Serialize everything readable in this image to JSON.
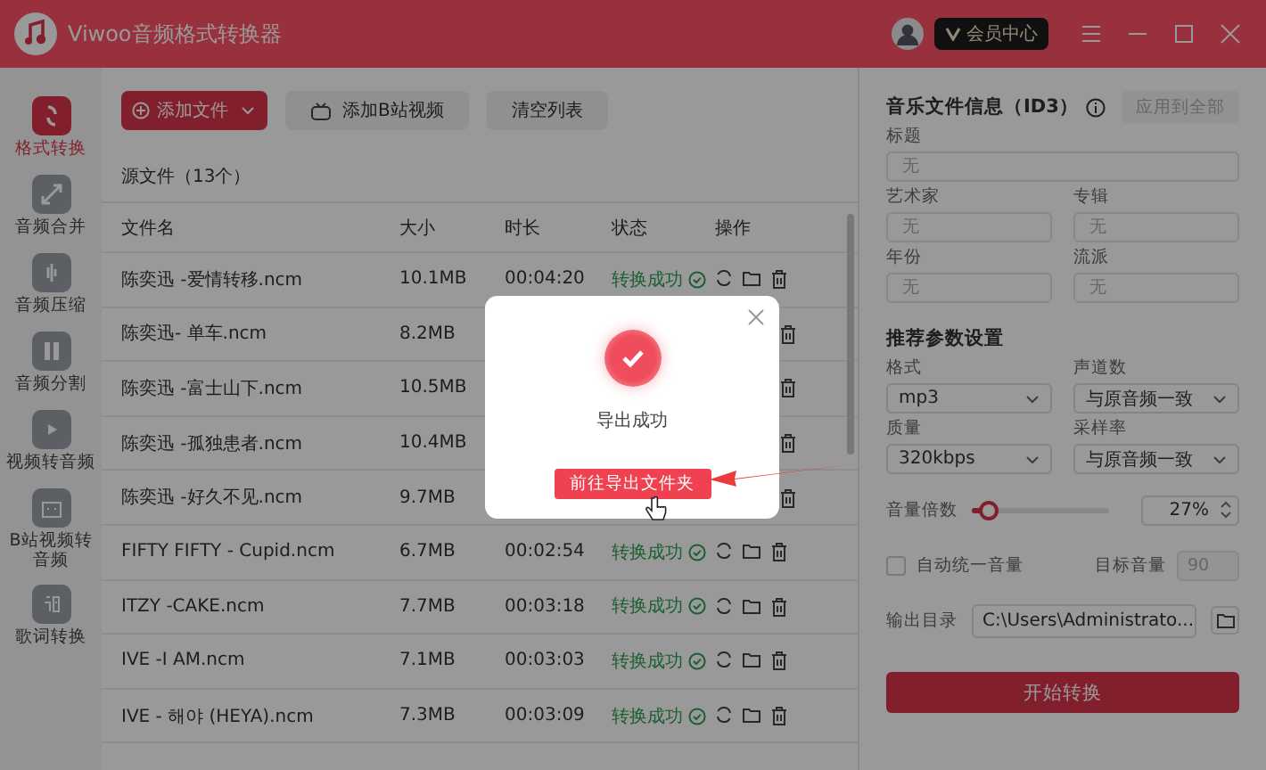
{
  "window": {
    "title": "Viwoo音频格式转换器",
    "member_button": "会员中心"
  },
  "sidebar": {
    "items": [
      {
        "label": "格式转换",
        "selected": true
      },
      {
        "label": "音频合并",
        "selected": false
      },
      {
        "label": "音频压缩",
        "selected": false
      },
      {
        "label": "音频分割",
        "selected": false
      },
      {
        "label": "视频转音频",
        "selected": false
      },
      {
        "label": "B站视频转音频",
        "selected": false
      },
      {
        "label": "歌词转换",
        "selected": false
      }
    ]
  },
  "toolbar": {
    "add_file": "添加文件",
    "add_bilibili": "添加B站视频",
    "clear": "清空列表"
  },
  "file_list": {
    "title": "源文件（13个）",
    "columns": [
      "文件名",
      "大小",
      "时长",
      "状态",
      "操作"
    ],
    "rows": [
      {
        "name": "陈奕迅 -爱情转移.ncm",
        "size": "10.1MB",
        "duration": "00:04:20",
        "status": "转换成功"
      },
      {
        "name": "陈奕迅- 单车.ncm",
        "size": "8.2MB"
      },
      {
        "name": "陈奕迅 -富士山下.ncm",
        "size": "10.5MB"
      },
      {
        "name": "陈奕迅 -孤独患者.ncm",
        "size": "10.4MB"
      },
      {
        "name": "陈奕迅 -好久不见.ncm",
        "size": "9.7MB"
      },
      {
        "name": "FIFTY FIFTY - Cupid.ncm",
        "size": "6.7MB",
        "duration": "00:02:54",
        "status": "转换成功"
      },
      {
        "name": "ITZY -CAKE.ncm",
        "size": "7.7MB",
        "duration": "00:03:18",
        "status": "转换成功"
      },
      {
        "name": "IVE -I AM.ncm",
        "size": "7.1MB",
        "duration": "00:03:03",
        "status": "转换成功"
      },
      {
        "name": "IVE - 해야 (HEYA).ncm",
        "size": "7.3MB",
        "duration": "00:03:09",
        "status": "转换成功"
      }
    ]
  },
  "id3": {
    "title": "音乐文件信息（ID3）",
    "apply_all": "应用到全部",
    "apply_all_disabled": true,
    "title_field": {
      "label": "标题",
      "placeholder": "无"
    },
    "fields": [
      {
        "label": "艺术家",
        "placeholder": "无"
      },
      {
        "label": "专辑",
        "placeholder": "无"
      },
      {
        "label": "年份",
        "placeholder": "无"
      },
      {
        "label": "流派",
        "placeholder": "无"
      }
    ]
  },
  "settings": {
    "title": "推荐参数设置",
    "selects": [
      {
        "label": "格式",
        "value": "mp3"
      },
      {
        "label": "声道数",
        "value": "与原音频一致"
      },
      {
        "label": "质量",
        "value": "320kbps"
      },
      {
        "label": "采样率",
        "value": "与原音频一致"
      }
    ],
    "volume": {
      "label": "音量倍数",
      "level": 0.12,
      "reading": "27%"
    },
    "auto_volume": {
      "label": "自动统一音量",
      "checked": false
    },
    "target_volume": {
      "label": "目标音量",
      "value": "90",
      "disabled": true
    },
    "output_dir": {
      "label": "输出目录",
      "value": "C:\\Users\\Administrato..."
    },
    "start_button": "开始转换"
  },
  "dialog": {
    "message": "导出成功",
    "button": "前往导出文件夹"
  }
}
